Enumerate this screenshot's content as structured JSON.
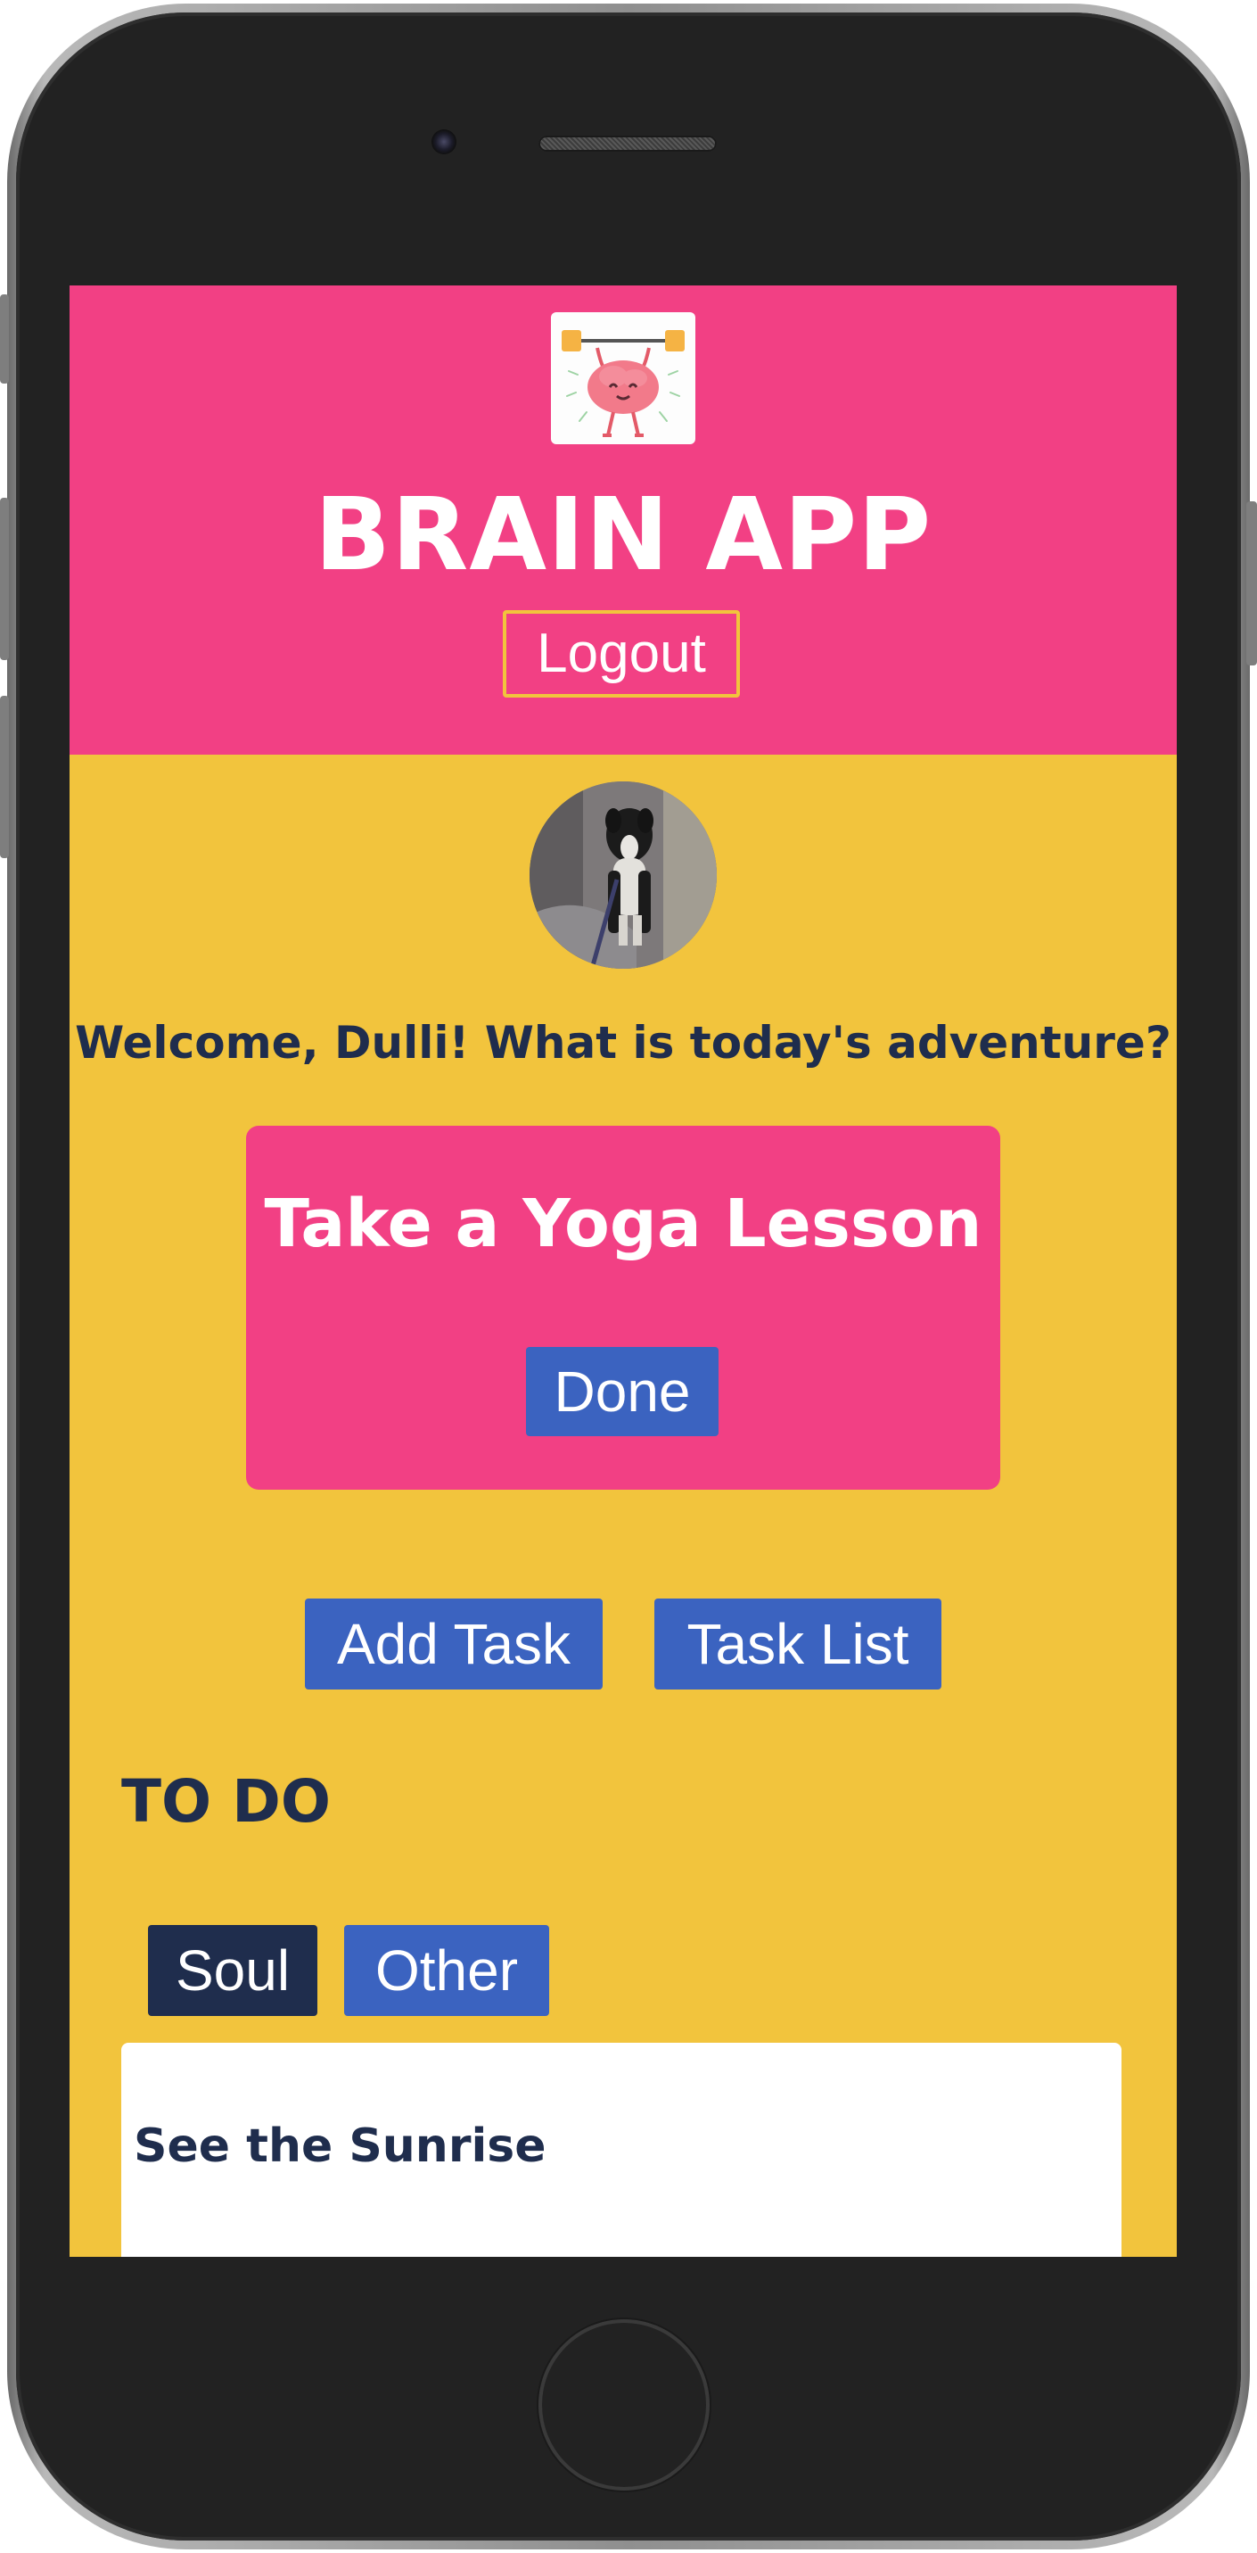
{
  "header": {
    "logo_icon": "brain-weightlifting-icon",
    "app_title": "BRAIN APP",
    "logout_label": "Logout"
  },
  "profile": {
    "avatar_icon": "dog-avatar-photo",
    "welcome_text": "Welcome, Dulli! What is today's adventure?"
  },
  "current_task": {
    "title": "Take a Yoga Lesson",
    "done_label": "Done"
  },
  "actions": {
    "add_task_label": "Add Task",
    "task_list_label": "Task List"
  },
  "todo": {
    "heading": "TO DO",
    "filters": [
      {
        "label": "Soul",
        "active": true
      },
      {
        "label": "Other",
        "active": false
      }
    ],
    "items": [
      {
        "title": "See the Sunrise"
      }
    ]
  },
  "colors": {
    "header_pink": "#f24084",
    "background_yellow": "#f2c43d",
    "button_blue": "#3b63c0",
    "navy_text": "#1f2d4d"
  }
}
